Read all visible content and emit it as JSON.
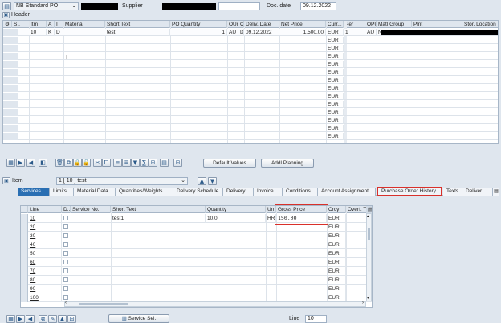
{
  "top": {
    "doc_type": "NB Standard PO",
    "supplier_label": "Supplier",
    "doc_date_label": "Doc. date",
    "doc_date": "09.12.2022",
    "header_label": "Header"
  },
  "items_table": {
    "columns": [
      "S..",
      "Itm",
      "A",
      "I",
      "Material",
      "Short Text",
      "PO Quantity",
      "OUn",
      "C",
      "Deliv. Date",
      "Net Price",
      "Curr...",
      "Per",
      "OPU",
      "Matl Group",
      "Plnt",
      "Stor. Location"
    ],
    "row1": {
      "itm": "10",
      "a": "K",
      "i": "D",
      "short_text": "test",
      "qty": "1",
      "oun": "AU",
      "c": "D",
      "deliv_date": "09.12.2022",
      "net_price": "1.500,00",
      "curr": "EUR",
      "per": "1",
      "opu": "AU",
      "matl_group": "N"
    },
    "empty_curr": [
      "EUR",
      "EUR",
      "EUR",
      "EUR",
      "EUR",
      "EUR",
      "EUR",
      "EUR",
      "EUR",
      "EUR",
      "EUR",
      "EUR",
      "EUR"
    ]
  },
  "toolbar": {
    "default_values": "Default Values",
    "addl_planning": "Addl Planning"
  },
  "item_detail": {
    "item_label": "Item",
    "item_value": "1 [ 10 ] test",
    "tabs": [
      "Services",
      "Limits",
      "Material Data",
      "Quantities/Weights",
      "Delivery Schedule",
      "Delivery",
      "Invoice",
      "Conditions",
      "Account Assignment",
      "Purchase Order History",
      "Texts",
      "Deliver..."
    ]
  },
  "services_table": {
    "columns": [
      "Line",
      "D..",
      "Service No.",
      "Short Text",
      "Quantity",
      "Un",
      "Gross Price",
      "Crcy",
      "Overf. T"
    ],
    "rows": [
      {
        "line": "10",
        "short_text": "test1",
        "qty": "10,0",
        "un": "HR",
        "gross": "150,00",
        "crcy": "EUR"
      },
      {
        "line": "20",
        "crcy": "EUR"
      },
      {
        "line": "30",
        "crcy": "EUR"
      },
      {
        "line": "40",
        "crcy": "EUR"
      },
      {
        "line": "50",
        "crcy": "EUR"
      },
      {
        "line": "60",
        "crcy": "EUR"
      },
      {
        "line": "70",
        "crcy": "EUR"
      },
      {
        "line": "80",
        "crcy": "EUR"
      },
      {
        "line": "90",
        "crcy": "EUR"
      },
      {
        "line": "100",
        "crcy": "EUR"
      }
    ]
  },
  "bottom": {
    "service_sel": "Service Sel.",
    "line_label": "Line",
    "line_value": "10"
  },
  "colors": {
    "accent": "#2a6fb3",
    "highlight": "#d9302a"
  }
}
